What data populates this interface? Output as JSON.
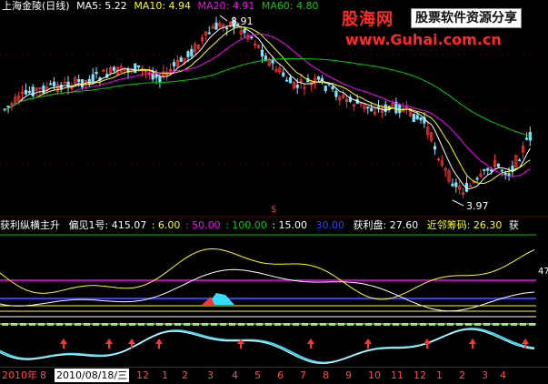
{
  "main_header": {
    "stock": "上海金陵(日线)",
    "ma5": "MA5: 5.22",
    "ma10": "MA10: 4.94",
    "ma20": "MA20: 4.91",
    "ma60": "MA60: 4.80"
  },
  "price_labels": {
    "high": "8.91",
    "low": "3.97",
    "s_marker": "$"
  },
  "watermark": {
    "brand": "股海网",
    "slogan": "股票软件资源分享",
    "url": "www.Guhai.com.cn"
  },
  "indicator_header": {
    "name": "获利纵横主升",
    "ref": "偏见1号: 415.07",
    "v1": ": 6.00",
    "v2": ": 50.00",
    "v3": ": 100.00",
    "v4": ": 15.00",
    "v5": "30.00",
    "profit": "获利盘: 27.60",
    "cost": "近邻筹码: 26.30",
    "more": "获"
  },
  "right_value": "47",
  "timeline": {
    "year_label": "2010年",
    "highlight_date": "2010/08/18/三",
    "months": [
      "8",
      "12",
      "1",
      "2",
      "3",
      "4",
      "5",
      "6",
      "7",
      "8",
      "9",
      "10",
      "11",
      "12",
      "1",
      "2",
      "3",
      "4"
    ]
  },
  "colors": {
    "up": "#ff3333",
    "down": "#7fe5ff",
    "ma5": "#ffffff",
    "ma10": "#ffff00",
    "ma20": "#ff00ff",
    "ma60": "#00cc00",
    "watermark_red": "#ff2a2a",
    "blue_line": "#3a3aff"
  }
}
